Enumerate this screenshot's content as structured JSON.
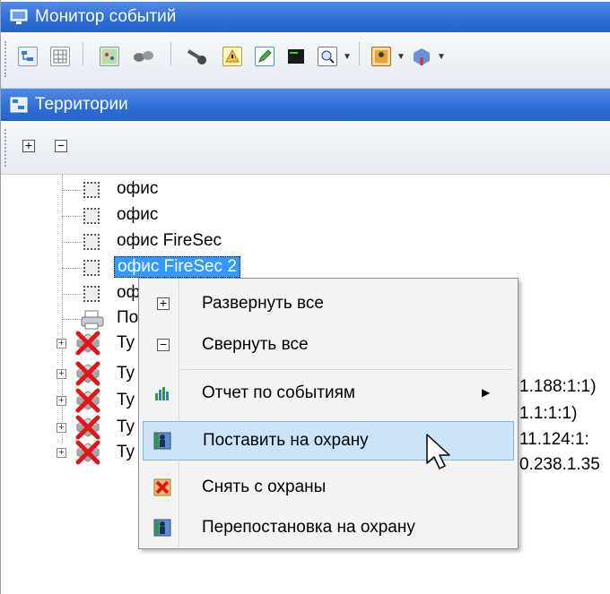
{
  "window": {
    "title": "Монитор событий"
  },
  "panel": {
    "title": "Территории"
  },
  "tree": {
    "items": [
      {
        "label": "офис"
      },
      {
        "label": "офис"
      },
      {
        "label": "офис FireSec"
      },
      {
        "label": "офис FireSec 2",
        "selected": true
      },
      {
        "label": "оф"
      },
      {
        "label": "По"
      },
      {
        "label": "Ту"
      },
      {
        "label": "Ту",
        "suffix": "1.188:1:1)"
      },
      {
        "label": "Ту",
        "suffix": "1.1:1:1)"
      },
      {
        "label": "Ту",
        "suffix": "11.124:1:"
      },
      {
        "label": "Ту",
        "suffix": "0.238.1.35"
      }
    ]
  },
  "context_menu": {
    "items": [
      {
        "label": "Развернуть все",
        "icon": "expand-icon"
      },
      {
        "label": "Свернуть все",
        "icon": "collapse-icon"
      },
      {
        "label": "Отчет по событиям",
        "icon": "chart-report-icon",
        "submenu": true
      },
      {
        "label": "Поставить на охрану",
        "icon": "arm-guard-icon",
        "highlighted": true
      },
      {
        "label": "Снять с охраны",
        "icon": "disarm-guard-icon"
      },
      {
        "label": "Перепостановка на охрану",
        "icon": "rearm-guard-icon"
      }
    ]
  },
  "colors": {
    "title_bar": "#2f6fd6",
    "selection": "#3399ff",
    "menu_highlight": "#cce4f7"
  }
}
